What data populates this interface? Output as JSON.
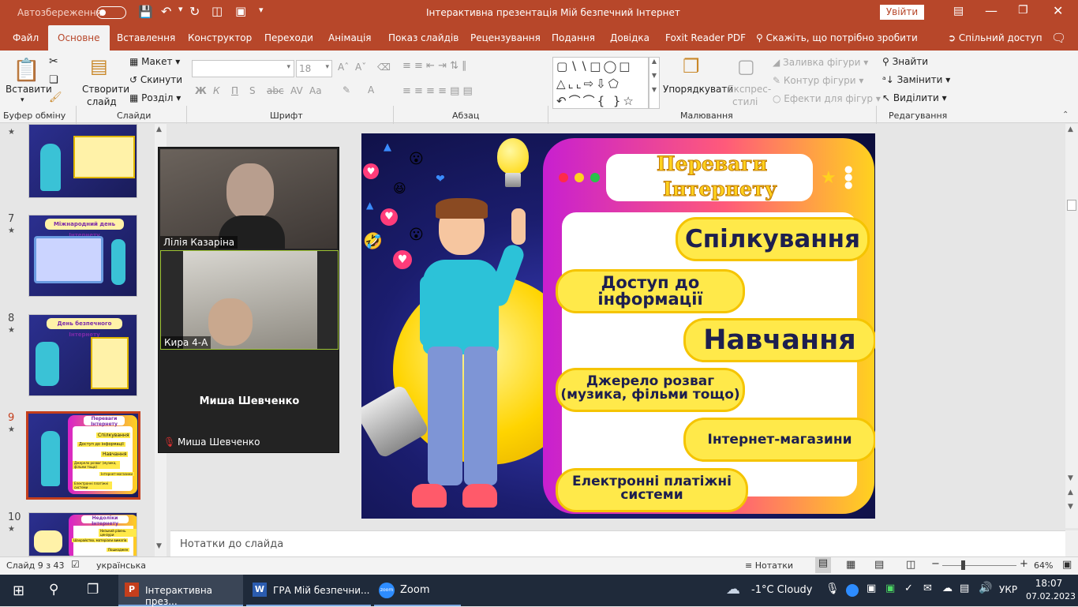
{
  "titlebar": {
    "autosave": "Автозбереження",
    "title": "Інтерактивна презентація Мій безпечний Інтернет",
    "signin": "Увійти"
  },
  "tabs": [
    "Файл",
    "Основне",
    "Вставлення",
    "Конструктор",
    "Переходи",
    "Анімація",
    "Показ слайдів",
    "Рецензування",
    "Подання",
    "Довідка",
    "Foxit Reader PDF"
  ],
  "tellme": "Скажіть, що потрібно зробити",
  "share": "Спільний доступ",
  "ribbon": {
    "paste": "Вставити",
    "new_slide_1": "Створити",
    "new_slide_2": "слайд",
    "layout": "Макет",
    "reset": "Скинути",
    "section": "Розділ",
    "font_size": "18",
    "bold": "Ж",
    "italic": "К",
    "underline": "П",
    "strike": "S",
    "spacing": "Аа",
    "arrange_1": "Упорядкувати",
    "styles_1": "Експрес-",
    "styles_2": "стилі",
    "fill": "Заливка фігури",
    "outline": "Контур фігури",
    "effects": "Ефекти для фігур",
    "find": "Знайти",
    "replace": "Замінити",
    "select": "Виділити",
    "groups": [
      "Буфер обміну",
      "Слайди",
      "Шрифт",
      "Абзац",
      "Малювання",
      "Редагування"
    ]
  },
  "thumbnails": [
    {
      "num": ""
    },
    {
      "num": "7"
    },
    {
      "num": "8"
    },
    {
      "num": "9"
    },
    {
      "num": "10"
    }
  ],
  "thumb_texts": {
    "t7_title": "Міжнародний день Інтернету",
    "t8_title": "День безпечного Інтернету",
    "t9_title": "Переваги Інтернету",
    "t9_items": [
      "Спілкування",
      "Доступ до інформації",
      "Навчання",
      "Джерело розваг (музика, фільми тощо)",
      "Інтернет-магазини",
      "Електронні платіжні системи"
    ],
    "t10_title": "Недоліки Інтернету",
    "t10_items": [
      "Низький рівень цензури",
      "Шахрайство, матеріали вимагів",
      "Пошкоджен"
    ]
  },
  "zoom": {
    "p1": "Лілія Казаріна",
    "p2": "Кира 4-А",
    "p3": "Миша Шевченко",
    "p3_label": "Миша Шевченко"
  },
  "slide": {
    "title_1": "Переваги",
    "title_2": "Інтернету",
    "b1": "Спілкування",
    "b2_1": "Доступ до",
    "b2_2": "інформації",
    "b3": "Навчання",
    "b4_1": "Джерело розваг",
    "b4_2": "(музика, фільми тощо)",
    "b5": "Інтернет-магазини",
    "b6_1": "Електронні платіжні",
    "b6_2": "системи"
  },
  "notes": "Нотатки до слайда",
  "status": {
    "slide": "Слайд 9 з 43",
    "lang": "українська",
    "notes": "Нотатки",
    "zoom": "64%"
  },
  "taskbar": {
    "app1": "Інтерактивна през...",
    "app2": "ГРА Мій безпечни...",
    "app3": "Zoom",
    "weather": "-1°C  Cloudy",
    "lang": "УКР",
    "time": "18:07",
    "date": "07.02.2023"
  },
  "colors": {
    "brand": "#b7472a",
    "bubble": "#ffe94a",
    "slide_bg": "#1b1d6e"
  }
}
